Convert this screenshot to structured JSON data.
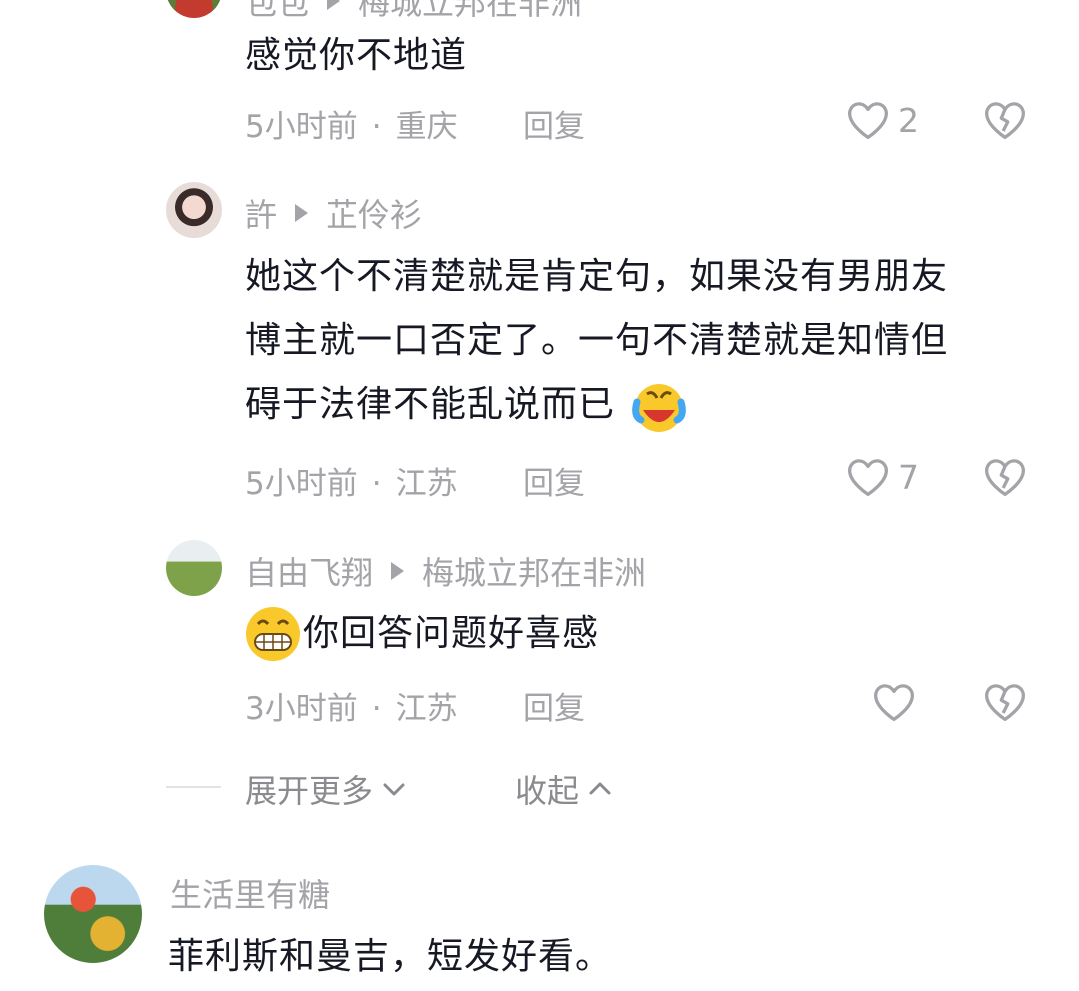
{
  "comments": [
    {
      "author": "包包",
      "reply_to": "梅城立邦在非洲",
      "text": "感觉你不地道",
      "time": "5小时前",
      "location": "重庆",
      "reply_label": "回复",
      "likes": "2"
    },
    {
      "author": "許",
      "reply_to": "芷伶衫",
      "text_lines": [
        "她这个不清楚就是肯定句，如果没有男朋友",
        "博主就一口否定了。一句不清楚就是知情但",
        "碍于法律不能乱说而已"
      ],
      "time": "5小时前",
      "location": "江苏",
      "reply_label": "回复",
      "likes": "7"
    },
    {
      "author": "自由飞翔",
      "reply_to": "梅城立邦在非洲",
      "text": "你回答问题好喜感",
      "time": "3小时前",
      "location": "江苏",
      "reply_label": "回复",
      "likes": ""
    }
  ],
  "expand_more": "展开更多",
  "collapse": "收起",
  "next_comment": {
    "author": "生活里有糖",
    "text": "菲利斯和曼吉，短发好看。"
  },
  "colors": {
    "primary_text": "#161823",
    "secondary_text": "#a3a3a8",
    "icon": "#a3a3a8"
  },
  "icons": [
    "heart-outline-icon",
    "broken-heart-icon",
    "chevron-down-icon",
    "chevron-up-icon",
    "laughing-tears-emoji",
    "grinning-emoji",
    "play-triangle-icon"
  ]
}
